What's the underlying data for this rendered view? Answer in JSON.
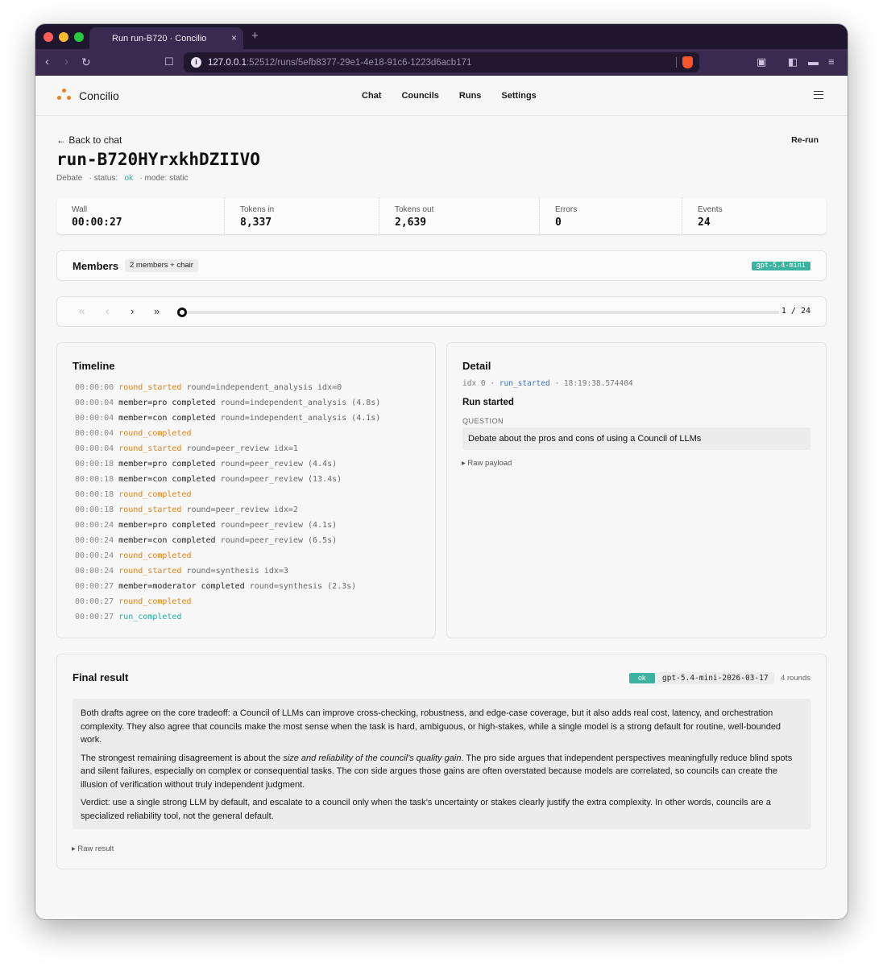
{
  "browser": {
    "tab_title": "Run run-B720 · Concilio",
    "tab_close": "×",
    "new_tab": "+",
    "url_host": "127.0.0.1",
    "url_path": ":52512/runs/5efb8377-29e1-4e18-91c6-1223d6acb171"
  },
  "app": {
    "brand": "Concilio",
    "nav": [
      "Chat",
      "Councils",
      "Runs",
      "Settings"
    ]
  },
  "run": {
    "back_label": "← Back to chat",
    "rerun_label": "Re-run",
    "title": "run-B720HYrxkhDZIIVO",
    "type": "Debate",
    "status_prefix": "· status:",
    "status": "ok",
    "mode": "· mode: static"
  },
  "stats": [
    {
      "label": "Wall",
      "value": "00:00:27"
    },
    {
      "label": "Tokens in",
      "value": "8,337"
    },
    {
      "label": "Tokens out",
      "value": "2,639"
    },
    {
      "label": "Errors",
      "value": "0"
    },
    {
      "label": "Events",
      "value": "24"
    }
  ],
  "members": {
    "title": "Members",
    "pill": "2 members + chair",
    "model": "gpt-5.4-mini"
  },
  "player": {
    "counter": "1 / 24",
    "position_fraction": 0.0
  },
  "timeline": {
    "title": "Timeline",
    "events": [
      {
        "ts": "00:00:00",
        "pre": "",
        "event": "round_started",
        "kind": "orange",
        "rest": " round=independent_analysis idx=0"
      },
      {
        "ts": "00:00:04",
        "pre": "member=pro completed",
        "event": "",
        "kind": "",
        "rest": " round=independent_analysis (4.8s)"
      },
      {
        "ts": "00:00:04",
        "pre": "member=con completed",
        "event": "",
        "kind": "",
        "rest": " round=independent_analysis (4.1s)"
      },
      {
        "ts": "00:00:04",
        "pre": "",
        "event": "round_completed",
        "kind": "orange",
        "rest": ""
      },
      {
        "ts": "00:00:04",
        "pre": "",
        "event": "round_started",
        "kind": "orange",
        "rest": " round=peer_review idx=1"
      },
      {
        "ts": "00:00:18",
        "pre": "member=pro completed",
        "event": "",
        "kind": "",
        "rest": " round=peer_review (4.4s)"
      },
      {
        "ts": "00:00:18",
        "pre": "member=con completed",
        "event": "",
        "kind": "",
        "rest": " round=peer_review (13.4s)"
      },
      {
        "ts": "00:00:18",
        "pre": "",
        "event": "round_completed",
        "kind": "orange",
        "rest": ""
      },
      {
        "ts": "00:00:18",
        "pre": "",
        "event": "round_started",
        "kind": "orange",
        "rest": " round=peer_review idx=2"
      },
      {
        "ts": "00:00:24",
        "pre": "member=pro completed",
        "event": "",
        "kind": "",
        "rest": " round=peer_review (4.1s)"
      },
      {
        "ts": "00:00:24",
        "pre": "member=con completed",
        "event": "",
        "kind": "",
        "rest": " round=peer_review (6.5s)"
      },
      {
        "ts": "00:00:24",
        "pre": "",
        "event": "round_completed",
        "kind": "orange",
        "rest": ""
      },
      {
        "ts": "00:00:24",
        "pre": "",
        "event": "round_started",
        "kind": "orange",
        "rest": " round=synthesis idx=3"
      },
      {
        "ts": "00:00:27",
        "pre": "member=moderator completed",
        "event": "",
        "kind": "",
        "rest": " round=synthesis (2.3s)"
      },
      {
        "ts": "00:00:27",
        "pre": "",
        "event": "round_completed",
        "kind": "orange",
        "rest": ""
      },
      {
        "ts": "00:00:27",
        "pre": "",
        "event": "run_completed",
        "kind": "teal",
        "rest": ""
      }
    ]
  },
  "detail": {
    "title": "Detail",
    "idx": "idx 0 ·",
    "event": "run_started",
    "time": "· 18:19:38.574404",
    "heading": "Run started",
    "question_label": "QUESTION",
    "question": "Debate about the pros and cons of using a Council of LLMs",
    "raw_payload": "▸ Raw payload"
  },
  "final": {
    "title": "Final result",
    "status": "ok",
    "model": "gpt-5.4-mini-2026-03-17",
    "rounds": "4 rounds",
    "p1": "Both drafts agree on the core tradeoff: a Council of LLMs can improve cross-checking, robustness, and edge-case coverage, but it also adds real cost, latency, and orchestration complexity. They also agree that councils make the most sense when the task is hard, ambiguous, or high-stakes, while a single model is a strong default for routine, well-bounded work.",
    "p2_a": "The strongest remaining disagreement is about the ",
    "p2_em": "size and reliability of the council’s quality gain",
    "p2_b": ". The pro side argues that independent perspectives meaningfully reduce blind spots and silent failures, especially on complex or consequential tasks. The con side argues those gains are often overstated because models are correlated, so councils can create the illusion of verification without truly independent judgment.",
    "p3": "Verdict: use a single strong LLM by default, and escalate to a council only when the task’s uncertainty or stakes clearly justify the extra complexity. In other words, councils are a specialized reliability tool, not the general default.",
    "raw_result": "▸ Raw result"
  }
}
